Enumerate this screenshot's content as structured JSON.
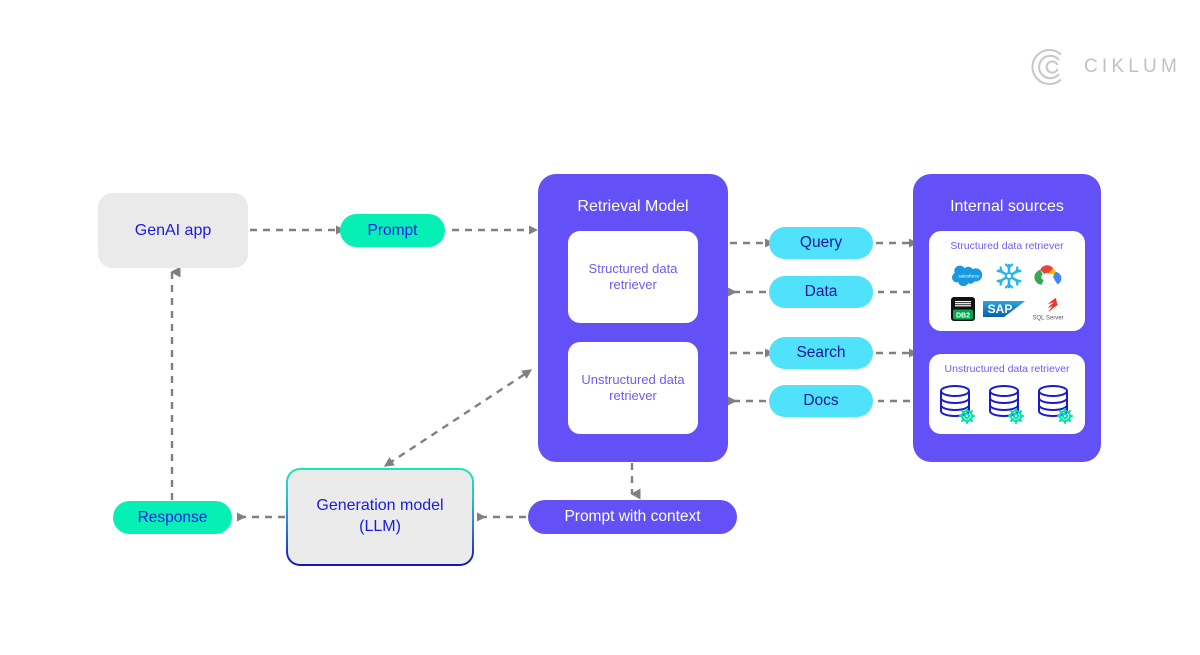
{
  "brand": {
    "name": "CIKLUM",
    "logo_icon": "ciklum-concentric-arc-logo",
    "color": "#c2c2c6"
  },
  "colors": {
    "purple": "#6350f6",
    "green": "#06f0b5",
    "cyan": "#51e2fb",
    "gray_box": "#eaeaea",
    "blue_text": "#1a1ae6",
    "arrow": "#808080"
  },
  "nodes": {
    "genai_app": {
      "label": "GenAI app"
    },
    "prompt": {
      "label": "Prompt"
    },
    "response": {
      "label": "Response"
    },
    "prompt_with_context": {
      "label": "Prompt with context"
    },
    "generation_model": {
      "label_line1": "Generation model",
      "label_line2": "(LLM)"
    }
  },
  "retrieval_model": {
    "title": "Retrieval Model",
    "boxes": [
      {
        "label_line1": "Structured data",
        "label_line2": "retriever"
      },
      {
        "label_line1": "Unstructured data",
        "label_line2": "retriever"
      }
    ]
  },
  "channels": [
    {
      "label": "Query",
      "direction": "right"
    },
    {
      "label": "Data",
      "direction": "left"
    },
    {
      "label": "Search",
      "direction": "right"
    },
    {
      "label": "Docs",
      "direction": "left"
    }
  ],
  "internal_sources": {
    "title": "Internal sources",
    "structured": {
      "label": "Structured data retriever",
      "logos": [
        {
          "name": "salesforce-logo",
          "text": "salesforce"
        },
        {
          "name": "snowflake-logo",
          "text": ""
        },
        {
          "name": "google-cloud-logo",
          "text": ""
        },
        {
          "name": "ibm-db2-logo",
          "text_top": "IBM",
          "text_bottom": "DB2"
        },
        {
          "name": "sap-logo",
          "text": "SAP"
        },
        {
          "name": "sql-server-logo",
          "text": "SQL Server"
        }
      ]
    },
    "unstructured": {
      "label": "Unstructured data retriever",
      "icons": [
        {
          "name": "database-gear-icon"
        },
        {
          "name": "database-gear-icon"
        },
        {
          "name": "database-gear-icon"
        }
      ]
    }
  }
}
